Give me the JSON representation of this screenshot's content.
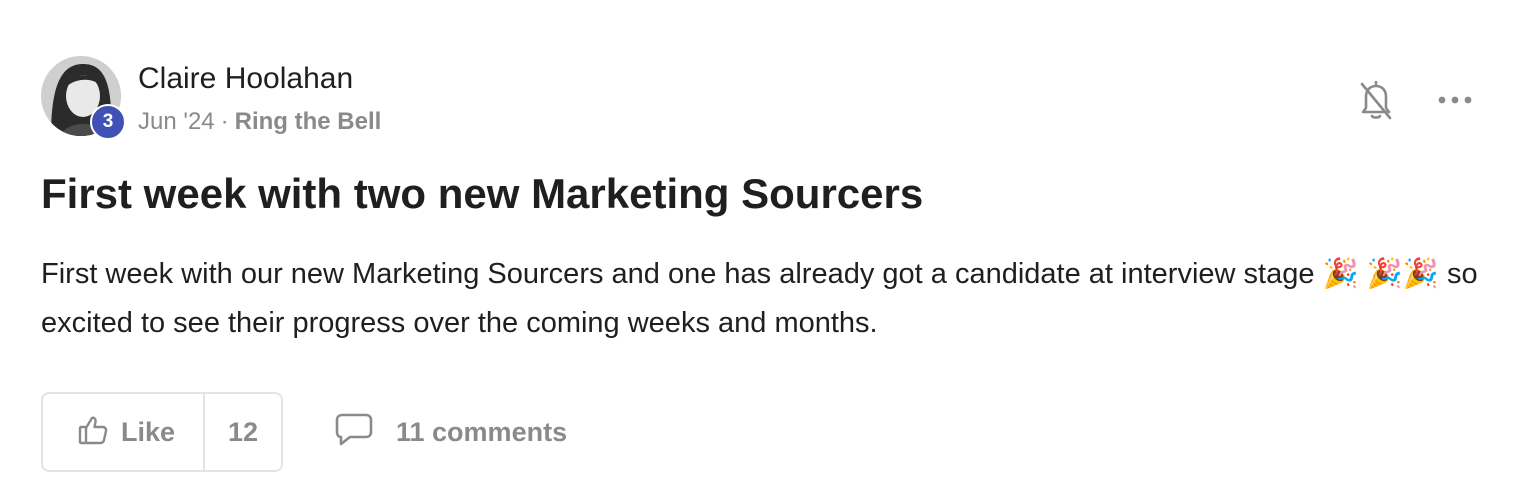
{
  "post": {
    "author_name": "Claire Hoolahan",
    "level": "3",
    "date": "Jun '24",
    "separator": "·",
    "space_name": "Ring the Bell",
    "title": "First week with two new Marketing Sourcers",
    "body": "First week with our new Marketing Sourcers and one has already got a candidate at interview stage 🎉 🎉🎉 so excited to see their progress over the coming weeks and months."
  },
  "actions": {
    "like_label": "Like",
    "like_count": "12",
    "comments_label": "11 comments"
  },
  "icons": {
    "notifications": "bell-off-icon",
    "menu": "more-horizontal-icon",
    "like": "thumbs-up-icon",
    "comment": "comment-bubble-icon"
  },
  "colors": {
    "level_badge": "#3f51b5",
    "text_primary": "#1f1f1f",
    "text_muted": "#8a8a8a",
    "border": "#e4e4e4"
  }
}
